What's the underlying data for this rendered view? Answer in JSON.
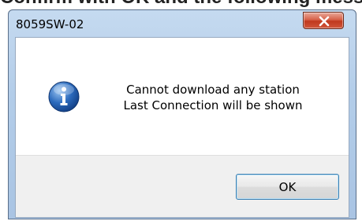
{
  "background_text": "Confirm with OK and the following message",
  "dialog": {
    "title": "8059SW-02",
    "message_line1": "Cannot download any station",
    "message_line2": "Last Connection will be shown",
    "icon": "info-icon",
    "ok_label": "OK",
    "close_icon": "close-icon"
  },
  "colors": {
    "frame": "#b3cde9",
    "close_button": "#c0391e",
    "info_icon": "#2c6bbd",
    "footer": "#f0f0f0"
  }
}
